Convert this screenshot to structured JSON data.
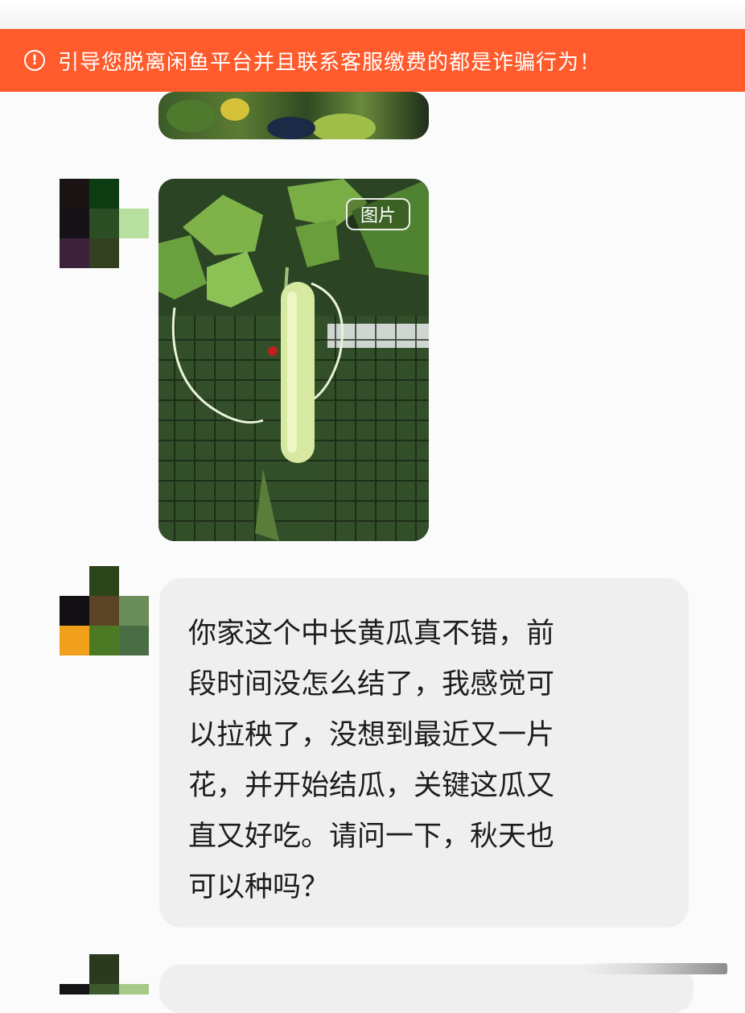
{
  "banner": {
    "icon": "alert-circle-icon",
    "icon_glyph": "!",
    "text": "引导您脱离闲鱼平台并且联系客服缴费的都是诈骗行为！",
    "background": "#ff5b2c"
  },
  "messages": {
    "image_message": {
      "tag_label": "图片"
    },
    "text_message": {
      "text": "你家这个中长黄瓜真不错，前\n段时间没怎么结了，我感觉可\n以拉秧了，没想到最近又一片\n花，并开始结瓜，关键这瓜又\n直又好吃。请问一下，秋天也\n可以种吗？"
    }
  }
}
